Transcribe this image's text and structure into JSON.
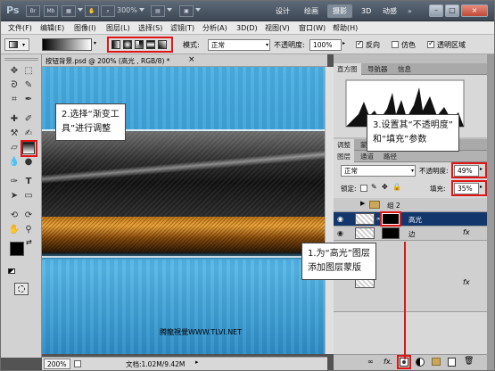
{
  "app": {
    "logo": "Ps"
  },
  "titlebar": {
    "zoom": "300%",
    "workspaces": [
      "设计",
      "绘画",
      "摄影",
      "3D",
      "动感"
    ],
    "active_workspace": "摄影",
    "bridge_label": "Br",
    "minibridge_label": "Mb",
    "more_label": "»",
    "controls": [
      "–",
      "□",
      "×"
    ]
  },
  "menubar": [
    "文件(F)",
    "编辑(E)",
    "图像(I)",
    "图层(L)",
    "选择(S)",
    "滤镜(T)",
    "分析(A)",
    "3D(D)",
    "视图(V)",
    "窗口(W)",
    "帮助(H)"
  ],
  "options": {
    "mode_label": "模式:",
    "mode_value": "正常",
    "opacity_label": "不透明度:",
    "opacity_value": "100%",
    "reverse_label": "反向",
    "dither_label": "仿色",
    "transparency_label": "透明区域"
  },
  "document": {
    "tab_title": "按钮背景.psd @ 200% (高光 , RGB/8) *",
    "close": "×",
    "status_zoom": "200%",
    "status_doc": "文档:1.02M/9.42M"
  },
  "panels": {
    "histogram_tabs": [
      "直方图",
      "导航器",
      "信息"
    ],
    "adjust_tabs": [
      "调整",
      "蒙版"
    ],
    "layers_tabs": [
      "图层",
      "通道",
      "路径"
    ],
    "blend_mode": "正常",
    "opacity_label": "不透明度:",
    "opacity_value": "49%",
    "lock_label": "锁定:",
    "fill_label": "填充:",
    "fill_value": "35%",
    "layers": [
      {
        "name": "组 2",
        "type": "group"
      },
      {
        "name": "高光",
        "type": "layer",
        "selected": true
      },
      {
        "name": "边",
        "type": "layer",
        "fx": "fx"
      }
    ],
    "fx_label": "fx",
    "bottom_icons": [
      "∞",
      "fx."
    ]
  },
  "callouts": {
    "step2_line1": "2.选择“渐变工",
    "step2_line2": "具”进行调整",
    "step3_line1": "3.设置其“不透明度”",
    "step3_line2": "和“填充”参数",
    "step1_line1": "1.为“高光”图层",
    "step1_line2": "添加图层蒙版"
  },
  "watermark": "腾龍視覺WWW.TLVI.NET",
  "colors": {
    "accent_red": "#e01616",
    "selected_layer": "#13376d",
    "canvas_blue": "#3a9fd5"
  }
}
